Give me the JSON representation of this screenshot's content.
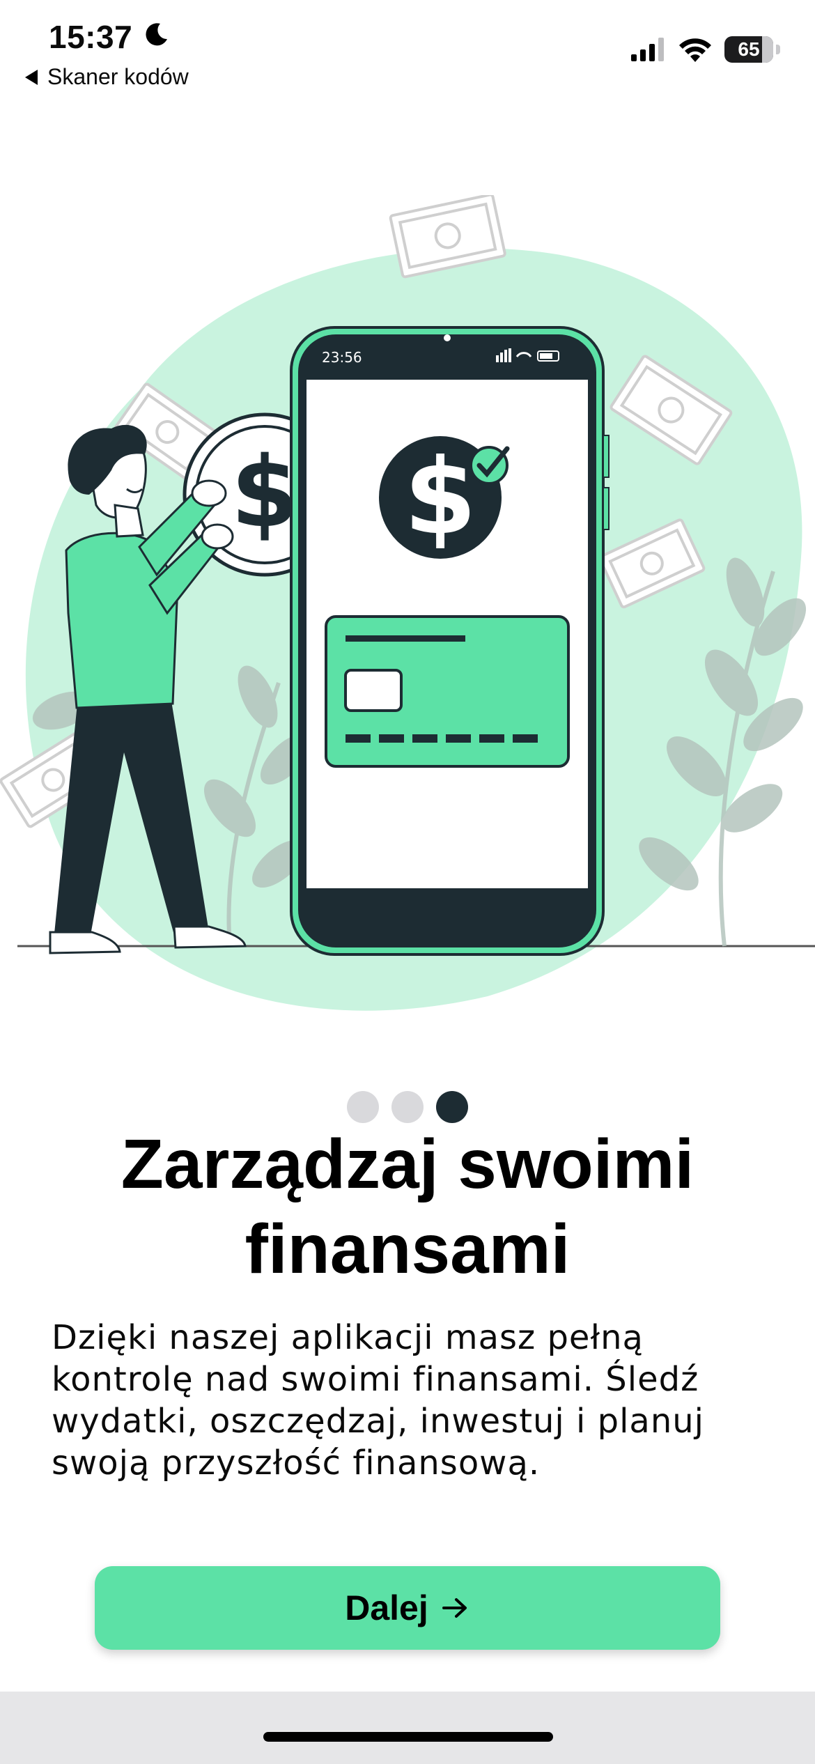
{
  "status_bar": {
    "time": "15:37",
    "back_label": "Skaner kodów",
    "battery_level": "65",
    "icons": [
      "moon-icon",
      "cellular-signal-icon",
      "wifi-icon",
      "battery-icon"
    ]
  },
  "illustration": {
    "phone_time": "23:56",
    "icons": [
      "dollar-coin-icon",
      "check-badge-icon",
      "credit-card-icon",
      "banknote-icon",
      "person-illustration",
      "plant-illustration"
    ]
  },
  "pager": {
    "total": 3,
    "active_index": 2
  },
  "onboarding": {
    "title": "Zarządzaj swoimi finansami",
    "description": "Dzięki naszej aplikacji masz pełną kontrolę nad swoimi finansami. Śledź wydatki, oszczędzaj, inwestuj i planuj swoją przyszłość finansową."
  },
  "cta": {
    "label": "Dalej",
    "icon": "arrow-right-icon"
  },
  "colors": {
    "accent": "#5ce1a6",
    "blob": "#c9f3df",
    "dark": "#1d2c33",
    "dot_inactive": "#d9d9dc",
    "home_area": "#e6e6e8"
  }
}
